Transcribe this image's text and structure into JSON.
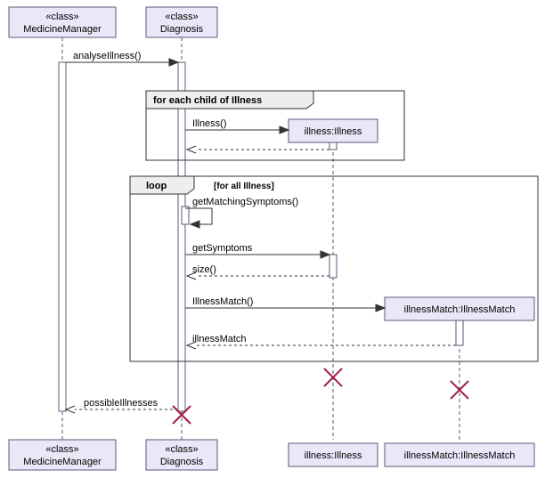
{
  "participants": {
    "medicineManager": {
      "stereotype": "«class»",
      "name": "MedicineManager"
    },
    "diagnosis": {
      "stereotype": "«class»",
      "name": "Diagnosis"
    },
    "illness": {
      "name": "illness:Illness"
    },
    "illnessMatch": {
      "name": "illnessMatch:IllnessMatch"
    }
  },
  "messages": {
    "analyseIllness": "analyseIllness()",
    "illnessCtor": "Illness()",
    "getMatchingSymptoms": "getMatchingSymptoms()",
    "getSymptoms": "getSymptoms",
    "size": "size()",
    "illnessMatchCtor": "IllnessMatch()",
    "illnessMatchReturn": "illnessMatch",
    "possibleIllnesses": "possibleIllnesses"
  },
  "frames": {
    "forEach": "for each child of Illness",
    "loop": "loop",
    "loopCond": "[for all Illness]"
  },
  "chart_data": {
    "type": "uml-sequence-diagram",
    "participants": [
      {
        "id": "MedicineManager",
        "stereotype": "class"
      },
      {
        "id": "Diagnosis",
        "stereotype": "class"
      },
      {
        "id": "illness:Illness",
        "created": true,
        "destroyed": true
      },
      {
        "id": "illnessMatch:IllnessMatch",
        "created": true,
        "destroyed": true
      }
    ],
    "interactions": [
      {
        "from": "MedicineManager",
        "to": "Diagnosis",
        "label": "analyseIllness()",
        "type": "sync"
      },
      {
        "fragment": "for each child of Illness",
        "contains": [
          {
            "from": "Diagnosis",
            "to": "illness:Illness",
            "label": "Illness()",
            "type": "create"
          },
          {
            "from": "illness:Illness",
            "to": "Diagnosis",
            "type": "return"
          }
        ]
      },
      {
        "fragment": "loop",
        "guard": "[for all Illness]",
        "contains": [
          {
            "from": "Diagnosis",
            "to": "Diagnosis",
            "label": "getMatchingSymptoms()",
            "type": "self"
          },
          {
            "from": "Diagnosis",
            "to": "illness:Illness",
            "label": "getSymptoms",
            "type": "sync"
          },
          {
            "from": "illness:Illness",
            "to": "Diagnosis",
            "label": "size()",
            "type": "return"
          },
          {
            "from": "Diagnosis",
            "to": "illnessMatch:IllnessMatch",
            "label": "IllnessMatch()",
            "type": "create"
          },
          {
            "from": "illnessMatch:IllnessMatch",
            "to": "Diagnosis",
            "label": "illnessMatch",
            "type": "return"
          }
        ]
      },
      {
        "from": "Diagnosis",
        "to": "MedicineManager",
        "label": "possibleIllnesses",
        "type": "return"
      }
    ]
  }
}
